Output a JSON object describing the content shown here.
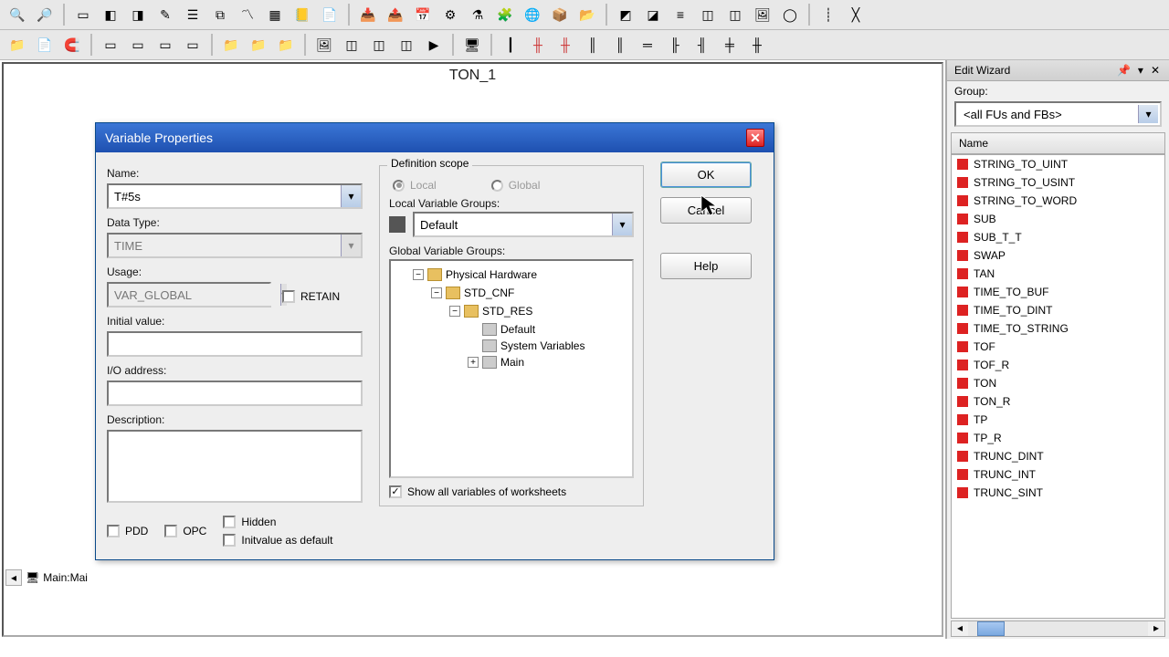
{
  "canvas": {
    "label": "TON_1"
  },
  "bottomTab": "Main:Mai",
  "dialog": {
    "title": "Variable Properties",
    "labels": {
      "name": "Name:",
      "dataType": "Data Type:",
      "usage": "Usage:",
      "retain": "RETAIN",
      "initial": "Initial value:",
      "ioaddr": "I/O address:",
      "desc": "Description:",
      "pdd": "PDD",
      "opc": "OPC",
      "hidden": "Hidden",
      "initDefault": "Initvalue as default",
      "defScope": "Definition scope",
      "local": "Local",
      "global": "Global",
      "localGroups": "Local Variable Groups:",
      "globalGroups": "Global Variable Groups:",
      "showAll": "Show all variables of worksheets"
    },
    "values": {
      "name": "T#5s",
      "dataType": "TIME",
      "usage": "VAR_GLOBAL",
      "localGroup": "Default"
    },
    "tree": {
      "root": "Physical Hardware",
      "l1": "STD_CNF",
      "l2": "STD_RES",
      "leaf1": "Default",
      "leaf2": "System Variables",
      "leaf3": "Main"
    },
    "buttons": {
      "ok": "OK",
      "cancel": "Cancel",
      "help": "Help"
    }
  },
  "wizard": {
    "title": "Edit Wizard",
    "groupLabel": "Group:",
    "groupValue": "<all FUs and FBs>",
    "columnHeader": "Name",
    "items": [
      "STRING_TO_UINT",
      "STRING_TO_USINT",
      "STRING_TO_WORD",
      "SUB",
      "SUB_T_T",
      "SWAP",
      "TAN",
      "TIME_TO_BUF",
      "TIME_TO_DINT",
      "TIME_TO_STRING",
      "TOF",
      "TOF_R",
      "TON",
      "TON_R",
      "TP",
      "TP_R",
      "TRUNC_DINT",
      "TRUNC_INT",
      "TRUNC_SINT"
    ]
  }
}
